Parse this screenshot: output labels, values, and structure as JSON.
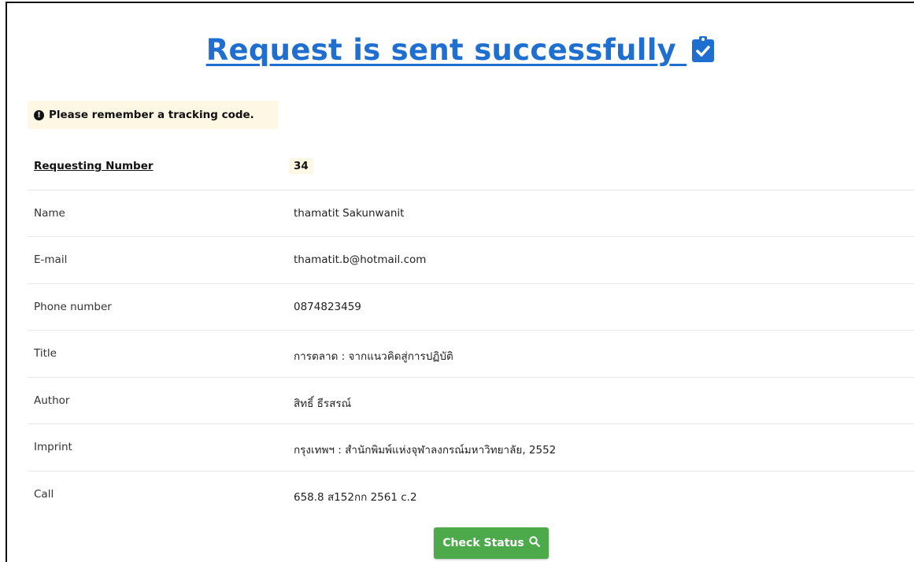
{
  "heading": "Request is sent successfully ",
  "notice": "Please remember a tracking code.",
  "details": [
    {
      "label": "Requesting Number",
      "value": "34"
    },
    {
      "label": "Name",
      "value": "thamatit Sakunwanit"
    },
    {
      "label": "E-mail",
      "value": "thamatit.b@hotmail.com"
    },
    {
      "label": "Phone number",
      "value": "0874823459"
    },
    {
      "label": "Title",
      "value": "การตลาด : จากแนวคิดสู่การปฏิบัติ"
    },
    {
      "label": "Author",
      "value": "สิทธิ์ ธีรสรณ์"
    },
    {
      "label": "Imprint",
      "value": "กรุงเทพฯ : สำนักพิมพ์แห่งจุฬาลงกรณ์มหาวิทยาลัย, 2552"
    },
    {
      "label": "Call",
      "value": "658.8 ส152กก 2561 c.2"
    }
  ],
  "button": {
    "label": "Check Status"
  },
  "colors": {
    "accent": "#1f6fd1",
    "button": "#4caa4a",
    "highlight": "#fdf7e3"
  },
  "icons": {
    "heading": "clipboard-check-icon",
    "notice": "info-circle-icon",
    "button": "search-icon"
  }
}
